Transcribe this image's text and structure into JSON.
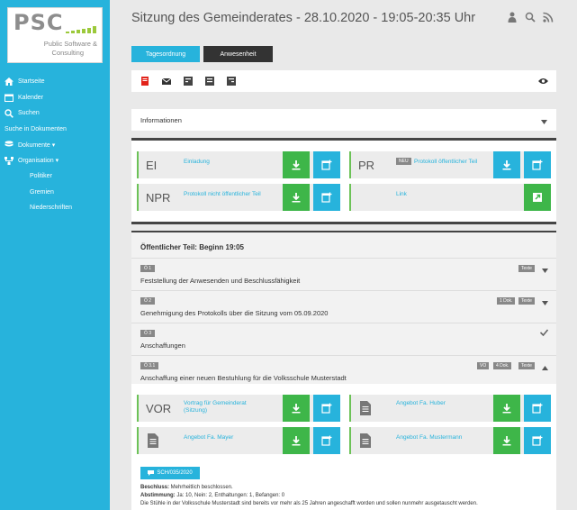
{
  "logo": {
    "brand": "PSC",
    "line1": "Public Software &",
    "line2": "Consulting"
  },
  "sidebar": {
    "items": [
      {
        "label": "Startseite",
        "icon": "home-icon"
      },
      {
        "label": "Kalender",
        "icon": "calendar-icon"
      },
      {
        "label": "Suchen",
        "icon": "search-icon"
      },
      {
        "label": "Suche in Dokumenten",
        "icon": ""
      },
      {
        "label": "Dokumente ▾",
        "icon": "database-icon"
      },
      {
        "label": "Organisation ▾",
        "icon": "sitemap-icon"
      },
      {
        "label": "Politiker",
        "icon": ""
      },
      {
        "label": "Gremien",
        "icon": ""
      },
      {
        "label": "Niederschriften",
        "icon": ""
      }
    ]
  },
  "header": {
    "title": "Sitzung des Gemeinderates - 28.10.2020 - 19:05-20:35 Uhr"
  },
  "tabs": [
    {
      "label": "Tagesordnung"
    },
    {
      "label": "Anwesenheit"
    }
  ],
  "info": {
    "label": "Informationen"
  },
  "docs": {
    "einladung": {
      "abbr": "EI",
      "label": "Einladung"
    },
    "protokoll_oeff": {
      "abbr": "PR",
      "badge": "NEU",
      "label": "Protokoll öffentlicher Teil"
    },
    "protokoll_nicht": {
      "abbr": "NPR",
      "label": "Protokoll nicht öffentlicher Teil"
    },
    "link": {
      "label": "Link"
    }
  },
  "agenda": {
    "heading": "Öffentlicher Teil: Beginn 19:05",
    "items": [
      {
        "num": "Ö 1",
        "title": "Feststellung der Anwesenden und Beschlussfähigkeit",
        "badges": [
          "Texte"
        ]
      },
      {
        "num": "Ö 2",
        "title": "Genehmigung des Protokolls über die Sitzung vom 05.09.2020",
        "badges": [
          "1 Dok.",
          "Texte"
        ]
      },
      {
        "num": "Ö 3",
        "title": "Anschaffungen",
        "badges": []
      },
      {
        "num": "Ö 3.1",
        "title": "Anschaffung einer neuen Bestuhlung für die Volksschule Musterstadt",
        "badges": [
          "VO",
          "4 Dok.",
          "Texte"
        ]
      }
    ],
    "subdocs": {
      "vortrag": {
        "abbr": "VOR",
        "label1": "Vortrag für Gemeinderat",
        "label2": "(Sitzung)"
      },
      "huber": {
        "label": "Angebot Fa. Huber"
      },
      "mayer": {
        "label": "Angebot Fa. Mayer"
      },
      "mustermann": {
        "label": "Angebot Fa. Mustermann"
      }
    },
    "sch": "SCH/035/2020",
    "beschluss_label": "Beschluss:",
    "beschluss_text": " Mehrheitlich beschlossen.",
    "abstimmung_label": "Abstimmung:",
    "abstimmung_text": " Ja: 10, Nein: 2, Enthaltungen: 1, Befangen: 0",
    "description": "Die Stühle in der Volksschule Musterstadt sind bereits vor mehr als 25 Jahren angeschafft worden und sollen nunmehr ausgetauscht werden."
  },
  "colors": {
    "accent": "#27b3dc",
    "green": "#3eb649",
    "dark": "#333333"
  }
}
